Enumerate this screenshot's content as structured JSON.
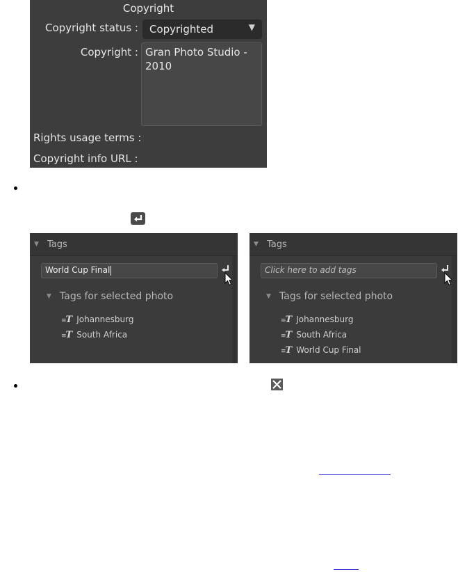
{
  "copyright_panel": {
    "title": "Copyright",
    "status_label": "Copyright status :",
    "status_value": "Copyrighted",
    "copyright_label": "Copyright :",
    "copyright_value": "Gran Photo Studio - 2010",
    "rights_label": "Rights usage terms :",
    "url_label": "Copyright info URL :"
  },
  "tags_left": {
    "header": "Tags",
    "input_value": "World Cup Final",
    "sub_header": "Tags for selected photo",
    "tags": [
      "Johannesburg",
      "South Africa"
    ]
  },
  "tags_right": {
    "header": "Tags",
    "input_placeholder": "Click here to add tags",
    "sub_header": "Tags for selected photo",
    "tags": [
      "Johannesburg",
      "South Africa",
      "World Cup Final"
    ]
  },
  "icons": {
    "enter": "enter-key-icon",
    "close": "close-icon",
    "tag": "tag-text-icon",
    "cursor": "mouse-pointer-icon",
    "dropdown": "triangle-down-icon"
  },
  "colors": {
    "panel_bg": "#3d3d3d",
    "panel_text": "#e6e6e6",
    "link": "#2a2ad0"
  }
}
